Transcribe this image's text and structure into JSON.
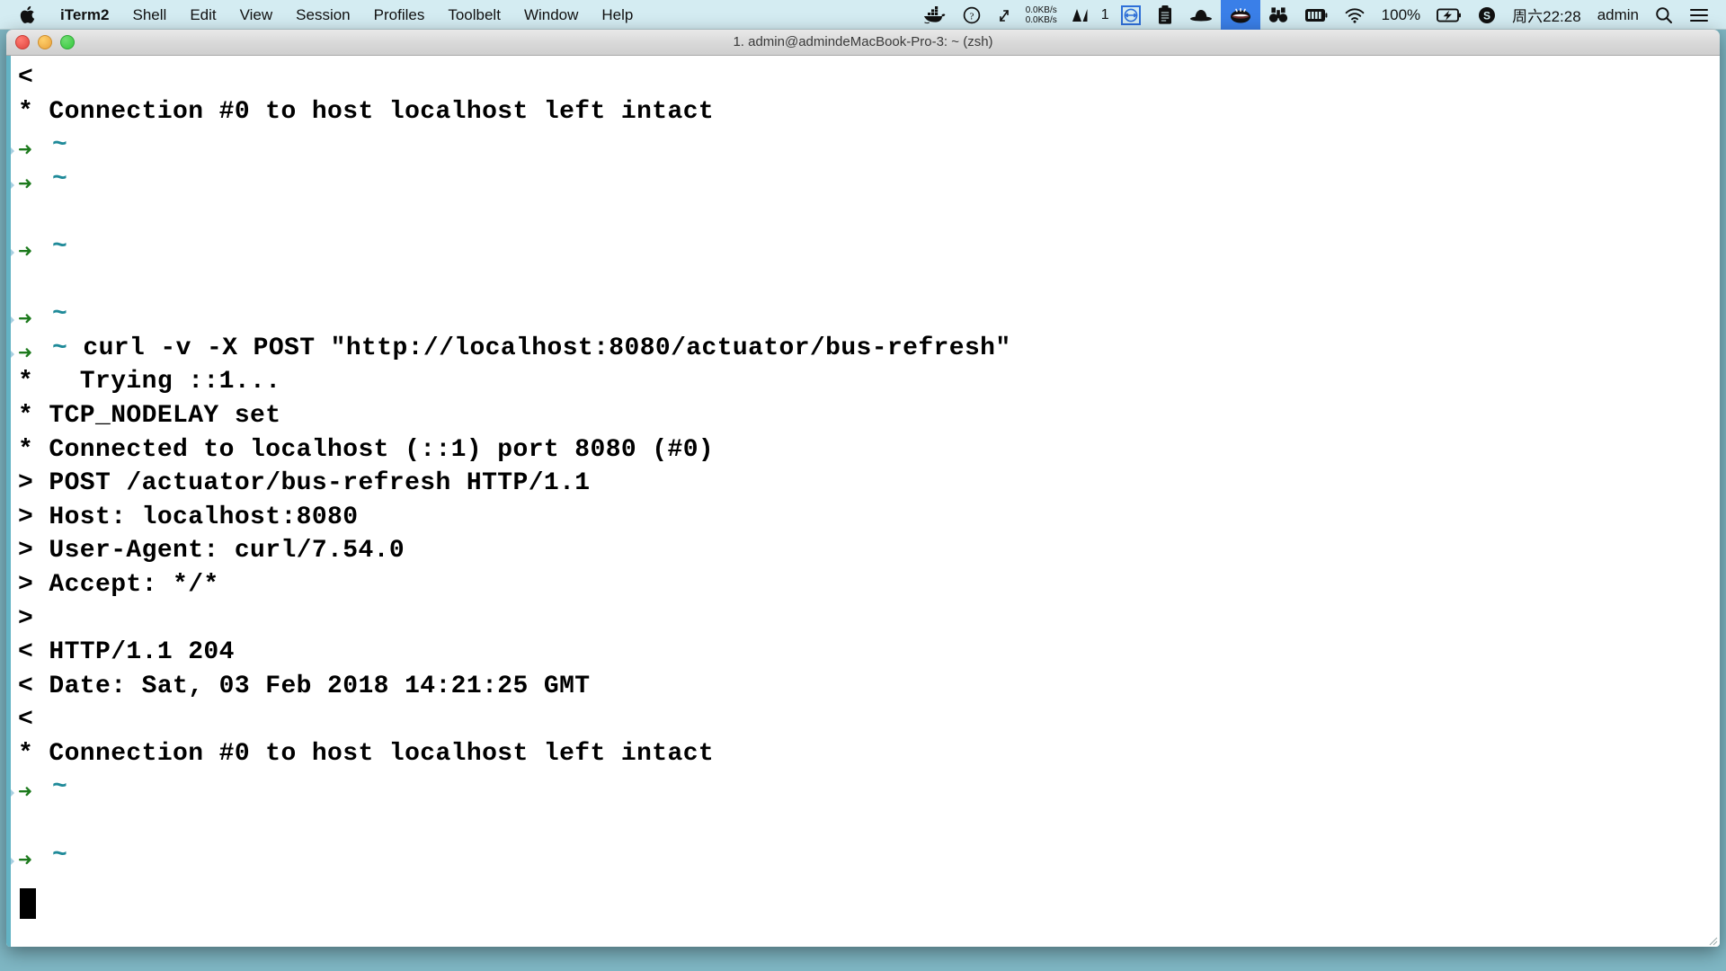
{
  "menubar": {
    "apple_icon": "apple-logo-icon",
    "items": [
      {
        "label": "iTerm2",
        "bold": true
      },
      {
        "label": "Shell",
        "bold": false
      },
      {
        "label": "Edit",
        "bold": false
      },
      {
        "label": "View",
        "bold": false
      },
      {
        "label": "Session",
        "bold": false
      },
      {
        "label": "Profiles",
        "bold": false
      },
      {
        "label": "Toolbelt",
        "bold": false
      },
      {
        "label": "Window",
        "bold": false
      },
      {
        "label": "Help",
        "bold": false
      }
    ],
    "status": {
      "docker_icon": "docker-whale-icon",
      "info_icon": "question-circle-icon",
      "expand_icon": "diagonal-arrows-icon",
      "net_up": "0.0KB/s",
      "net_down": "0.0KB/s",
      "mountain_icon": "istat-graph-icon",
      "mountain_count": "1",
      "teamviewer_icon": "teamviewer-arrows-icon",
      "clipboard_icon": "clipboard-icon",
      "bowler_icon": "bowler-hat-icon",
      "mouth_icon": "open-mouth-icon",
      "binoculars_icon": "binoculars-icon",
      "battery_bars_icon": "battery-bars-icon",
      "wifi_icon": "wifi-icon",
      "battery_percent": "100%",
      "battery_icon": "battery-charging-icon",
      "skype_icon": "skype-icon",
      "datetime": "周六22:28",
      "user": "admin",
      "search_icon": "spotlight-search-icon",
      "controlcenter_icon": "notification-center-icon"
    }
  },
  "window": {
    "title": "1. admin@admindeMacBook-Pro-3: ~ (zsh)",
    "close_label": "close-window",
    "minimize_label": "minimize-window",
    "maximize_label": "maximize-window"
  },
  "terminal": {
    "prompt_arrow": "➜",
    "prompt_dir": "~",
    "cursor_visible": true,
    "lines": [
      {
        "type": "out",
        "text": "<"
      },
      {
        "type": "out",
        "text": "* Connection #0 to host localhost left intact"
      },
      {
        "type": "prompt",
        "text": ""
      },
      {
        "type": "prompt",
        "text": ""
      },
      {
        "type": "blank",
        "text": ""
      },
      {
        "type": "prompt",
        "text": ""
      },
      {
        "type": "blank",
        "text": ""
      },
      {
        "type": "prompt",
        "text": ""
      },
      {
        "type": "prompt",
        "text": "curl -v -X POST \"http://localhost:8080/actuator/bus-refresh\""
      },
      {
        "type": "out",
        "text": "*   Trying ::1..."
      },
      {
        "type": "out",
        "text": "* TCP_NODELAY set"
      },
      {
        "type": "out",
        "text": "* Connected to localhost (::1) port 8080 (#0)"
      },
      {
        "type": "out",
        "text": "> POST /actuator/bus-refresh HTTP/1.1"
      },
      {
        "type": "out",
        "text": "> Host: localhost:8080"
      },
      {
        "type": "out",
        "text": "> User-Agent: curl/7.54.0"
      },
      {
        "type": "out",
        "text": "> Accept: */*"
      },
      {
        "type": "out",
        "text": ">"
      },
      {
        "type": "out",
        "text": "< HTTP/1.1 204"
      },
      {
        "type": "out",
        "text": "< Date: Sat, 03 Feb 2018 14:21:25 GMT"
      },
      {
        "type": "out",
        "text": "<"
      },
      {
        "type": "out",
        "text": "* Connection #0 to host localhost left intact"
      },
      {
        "type": "prompt",
        "text": ""
      },
      {
        "type": "blank",
        "text": ""
      },
      {
        "type": "prompt",
        "text": ""
      }
    ]
  },
  "colors": {
    "menubar_bg": "#d4ecf2",
    "desktop_bg": "#7fb7c4",
    "terminal_bg": "#ffffff",
    "terminal_fg": "#000000",
    "prompt_green": "#1d7a1d",
    "tilde_cyan": "#1f8a99",
    "accent_blue": "#3a7fe8"
  }
}
